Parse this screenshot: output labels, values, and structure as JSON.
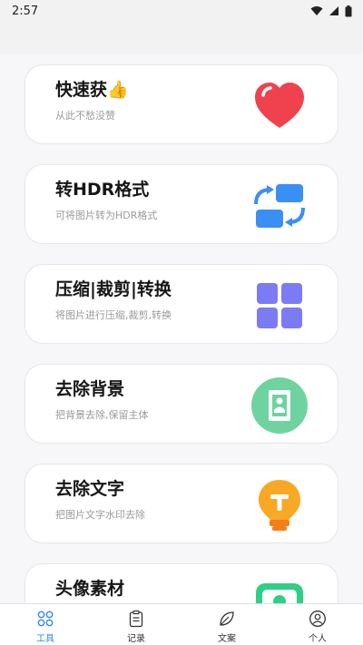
{
  "status_bar": {
    "time": "2:57"
  },
  "cards": [
    {
      "title": "快速获👍",
      "subtitle": "从此不愁没赞",
      "icon": "heart-icon"
    },
    {
      "title": "转HDR格式",
      "subtitle": "可将图片转为HDR格式",
      "icon": "convert-arrows-icon"
    },
    {
      "title": "压缩|裁剪|转换",
      "subtitle": "将图片进行压缩,裁剪,转换",
      "icon": "grid-icon"
    },
    {
      "title": "去除背景",
      "subtitle": "把背景去除,保留主体",
      "icon": "document-portrait-icon"
    },
    {
      "title": "去除文字",
      "subtitle": "把图片文字水印去除",
      "icon": "lightbulb-icon"
    },
    {
      "title": "头像素材",
      "subtitle": "",
      "icon": "avatar-photo-icon"
    }
  ],
  "tabs": [
    {
      "label": "工具",
      "icon": "tools-icon",
      "active": true
    },
    {
      "label": "记录",
      "icon": "clipboard-icon",
      "active": false
    },
    {
      "label": "文案",
      "icon": "leaf-icon",
      "active": false
    },
    {
      "label": "个人",
      "icon": "person-icon",
      "active": false
    }
  ],
  "colors": {
    "accent": "#2e86f5",
    "heart": "#f0414e",
    "convert_blue": "#3a8ff5",
    "grid_purple": "#7b7cf3",
    "bg_green": "#6fd3a0",
    "bulb_orange": "#f9a825",
    "photo_green": "#2fcf86"
  }
}
